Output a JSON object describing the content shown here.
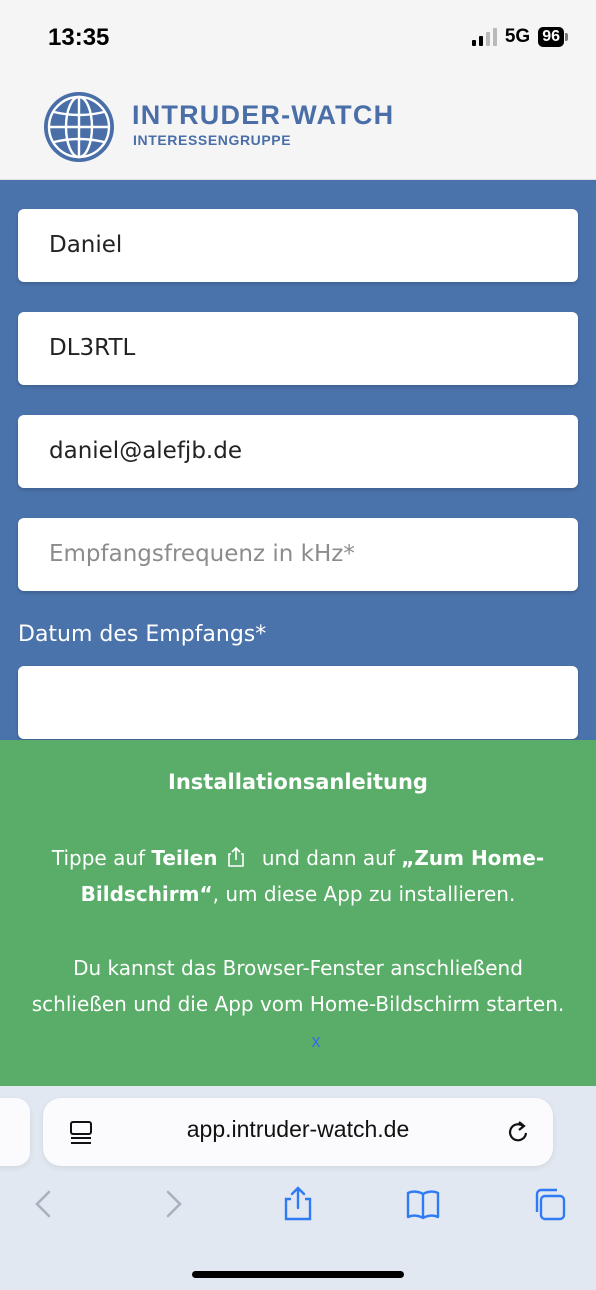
{
  "status_bar": {
    "time": "13:35",
    "network": "5G",
    "battery": "96"
  },
  "header": {
    "title": "INTRUDER-WATCH",
    "subtitle": "INTERESSENGRUPPE",
    "logo_icon": "globe-icon",
    "brand_color": "#4a6fa8"
  },
  "form": {
    "background_color": "#4a72ab",
    "name_value": "Daniel",
    "callsign_value": "DL3RTL",
    "email_value": "daniel@alefjb.de",
    "frequency_placeholder": "Empfangsfrequenz in kHz*",
    "date_label": "Datum des Empfangs*",
    "date_value": ""
  },
  "install_banner": {
    "background_color": "#5aad69",
    "title": "Installationsanleitung",
    "line1_prefix": "Tippe auf ",
    "line1_bold1": "Teilen",
    "line1_middle": " und dann auf ",
    "line1_bold2": "„Zum Home-Bildschirm“",
    "line1_suffix": ", um diese App zu installieren.",
    "line2": "Du kannst das Browser-Fenster anschließend schließen und die App vom Home-Bildschirm starten.",
    "close_label": "x",
    "share_icon": "share-icon"
  },
  "browser": {
    "url": "app.intruder-watch.de",
    "toolbar_icons": [
      "back-icon",
      "forward-icon",
      "share-icon",
      "bookmarks-icon",
      "tabs-icon"
    ],
    "accent_color": "#2f7bf5"
  }
}
